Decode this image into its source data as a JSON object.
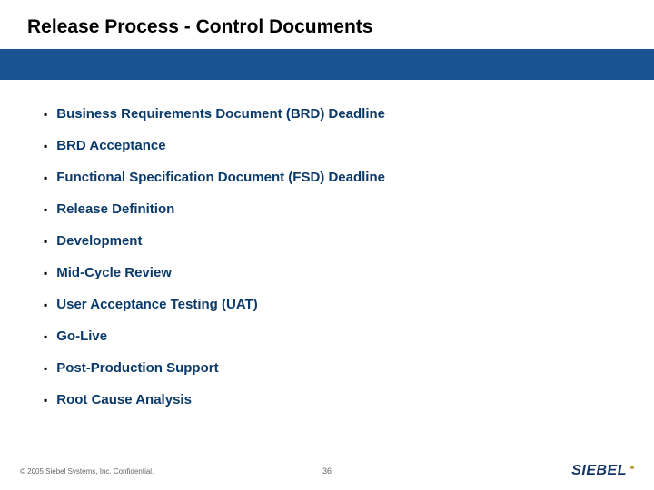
{
  "title": "Release Process - Control Documents",
  "bullets": [
    "Business Requirements Document (BRD) Deadline",
    "BRD Acceptance",
    "Functional Specification Document (FSD) Deadline",
    "Release Definition",
    "Development",
    "Mid-Cycle Review",
    "User Acceptance Testing (UAT)",
    "Go-Live",
    "Post-Production Support",
    "Root Cause Analysis"
  ],
  "footer": {
    "copyright": "© 2005 Siebel Systems, Inc. Confidential.",
    "page": "36",
    "logo": "SIEBEL"
  }
}
